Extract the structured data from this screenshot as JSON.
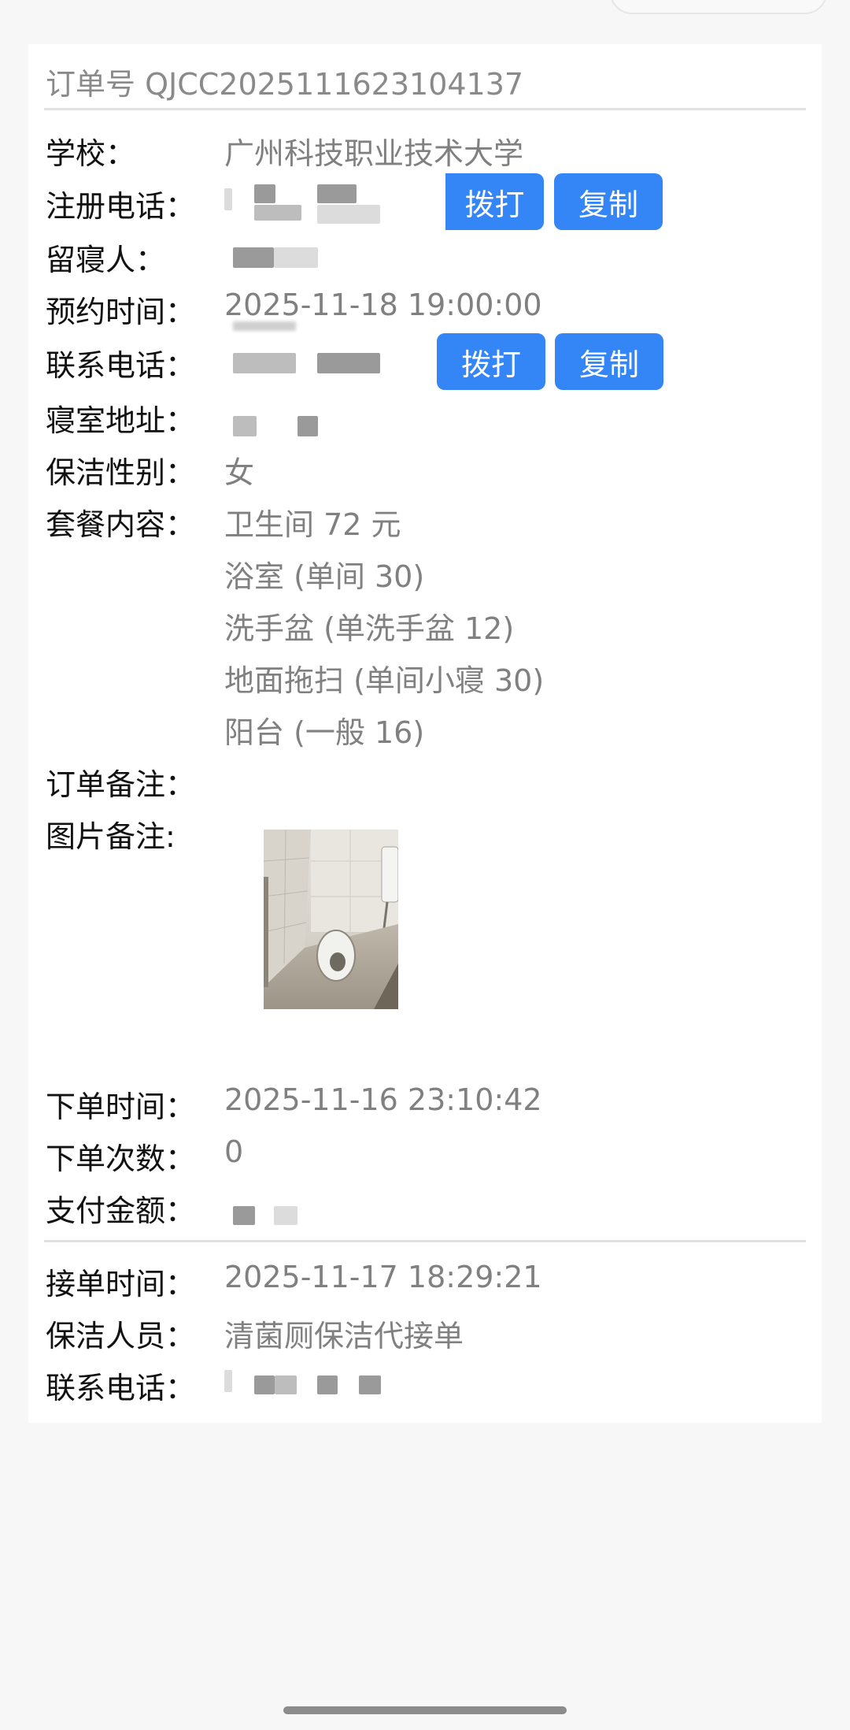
{
  "order": {
    "number_label": "订单号 QJCC2025111623104137"
  },
  "fields": {
    "school": {
      "label": "学校：",
      "value": "广州科技职业技术大学"
    },
    "reg_phone": {
      "label": "注册电话："
    },
    "occupant": {
      "label": "留寝人："
    },
    "appointment": {
      "label": "预约时间：",
      "value": "2025-11-18 19:00:00"
    },
    "contact_phone": {
      "label": "联系电话："
    },
    "dorm_address": {
      "label": "寝室地址："
    },
    "cleaner_gender": {
      "label": "保洁性别：",
      "value": "女"
    },
    "package": {
      "label": "套餐内容：",
      "items": [
        "卫生间 72 元",
        "浴室 (单间 30)",
        "洗手盆 (单洗手盆 12)",
        "地面拖扫 (单间小寝 30)",
        "阳台 (一般 16)"
      ]
    },
    "order_note": {
      "label": "订单备注："
    },
    "image_note": {
      "label": "图片备注:"
    },
    "order_time": {
      "label": "下单时间：",
      "value": "2025-11-16 23:10:42"
    },
    "order_count": {
      "label": "下单次数：",
      "value": "0"
    },
    "payment": {
      "label": "支付金额："
    },
    "accept_time": {
      "label": "接单时间：",
      "value": "2025-11-17 18:29:21"
    },
    "cleaner": {
      "label": "保洁人员：",
      "value": "清菌厕保洁代接单"
    },
    "cleaner_phone": {
      "label": "联系电话："
    }
  },
  "buttons": {
    "call": "拨打",
    "copy": "复制"
  },
  "colors": {
    "accent": "#3485f6",
    "page_bg": "#f7f7f7",
    "card_bg": "#ffffff",
    "label_text": "#111111",
    "value_text": "#808080"
  },
  "icons": {
    "photo": "bathroom-photo-thumbnail"
  }
}
